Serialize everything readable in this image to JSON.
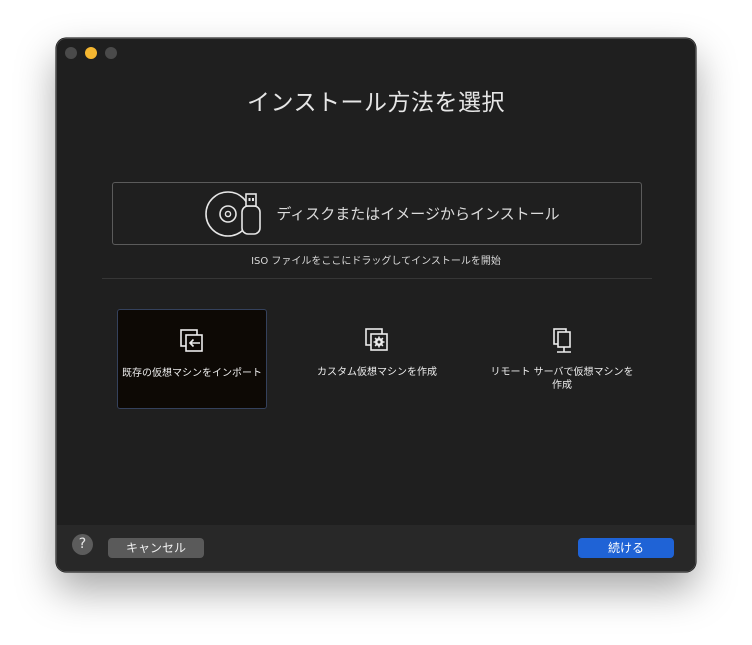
{
  "window": {
    "title": "インストール方法を選択"
  },
  "disc": {
    "label": "ディスクまたはイメージからインストール",
    "hint": "ISO ファイルをここにドラッグしてインストールを開始"
  },
  "options": [
    {
      "label": "既存の仮想マシンをインポート",
      "icon": "import-vm-icon",
      "selected": true
    },
    {
      "label": "カスタム仮想マシンを作成",
      "icon": "custom-vm-gear-icon",
      "selected": false
    },
    {
      "label": "リモート サーバで仮想マシンを作成",
      "icon": "remote-server-icon",
      "selected": false
    }
  ],
  "footer": {
    "help": "?",
    "cancel": "キャンセル",
    "continue": "続ける"
  },
  "colors": {
    "accent": "#1f63d6",
    "window_bg": "#1f1f1f",
    "selected_bg": "#0d0905"
  }
}
